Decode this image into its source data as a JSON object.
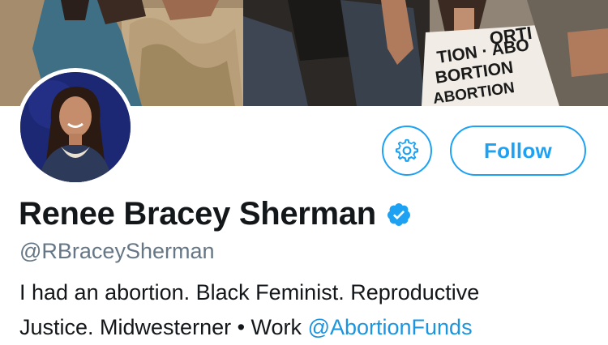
{
  "header": {
    "photo_description": "",
    "banner_text": [
      "ORTI",
      "TION · ABO",
      "BORTION",
      "ABORTION"
    ]
  },
  "profile": {
    "display_name": "Renee Bracey Sherman",
    "handle": "@RBraceySherman",
    "verified": true,
    "bio_line1": "I had an abortion. Black Feminist. Reproductive",
    "bio_line2_prefix": "Justice. Midwesterner • Work ",
    "bio_mention": "@AbortionFunds"
  },
  "actions": {
    "settings_icon": "gear-icon",
    "follow_label": "Follow"
  },
  "colors": {
    "accent": "#1da1f2",
    "mention": "#1b95e0",
    "secondary_text": "#657786",
    "primary_text": "#14171a"
  }
}
